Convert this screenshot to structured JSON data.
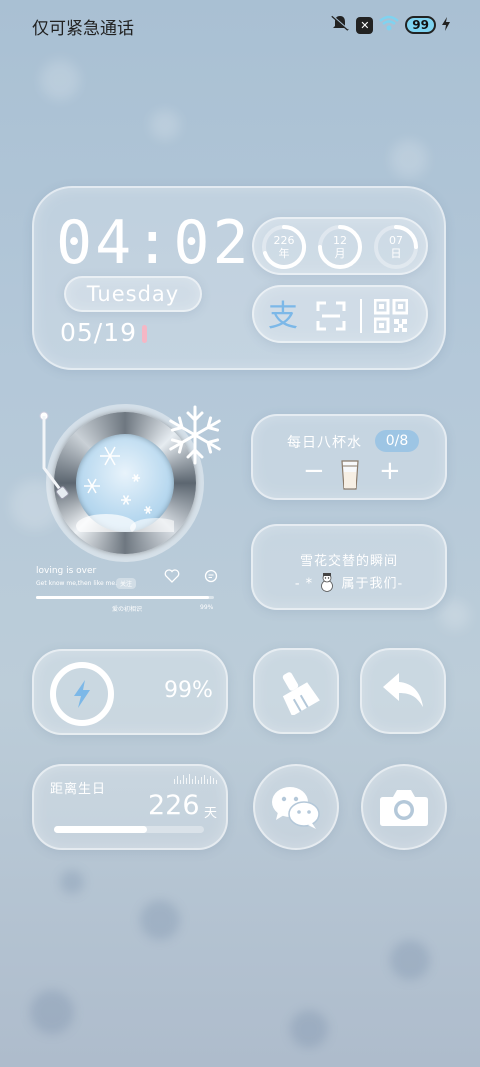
{
  "status_bar": {
    "carrier": "仅可紧急通话",
    "battery": "99"
  },
  "clock": {
    "time": "04:02",
    "weekday": "Tuesday",
    "date": "05/19",
    "rings": [
      {
        "value": "226",
        "unit": "年"
      },
      {
        "value": "12",
        "unit": "月"
      },
      {
        "value": "07",
        "unit": "日"
      }
    ]
  },
  "music": {
    "title": "loving is over",
    "subtitle": "Get know me,then like me.",
    "tag": "关注",
    "progress_label": "爱の初相识",
    "progress_percent": "99%",
    "progress_fraction": 0.97
  },
  "water": {
    "title": "每日八杯水",
    "count": "0/8",
    "minus": "−",
    "plus": "+"
  },
  "quote": {
    "line1": "雪花交替的瞬间",
    "line2_prefix": "- *",
    "line2_suffix": "属于我们-"
  },
  "battery_widget": {
    "percent": "99%",
    "level": 0.99
  },
  "birthday": {
    "label": "距离生日",
    "days": "226",
    "unit": "天",
    "progress_fraction": 0.62
  },
  "icons": {
    "alipay": "alipay-icon",
    "scan": "scan-icon",
    "qr": "qr-code-icon",
    "cleaner": "brush-icon",
    "back": "back-arrow-icon",
    "wechat": "wechat-icon",
    "camera": "camera-icon"
  },
  "colors": {
    "accent_blue": "#7cb8e8",
    "date_mark": "#f5b7c5",
    "battery_pill": "#7fd3f0"
  }
}
